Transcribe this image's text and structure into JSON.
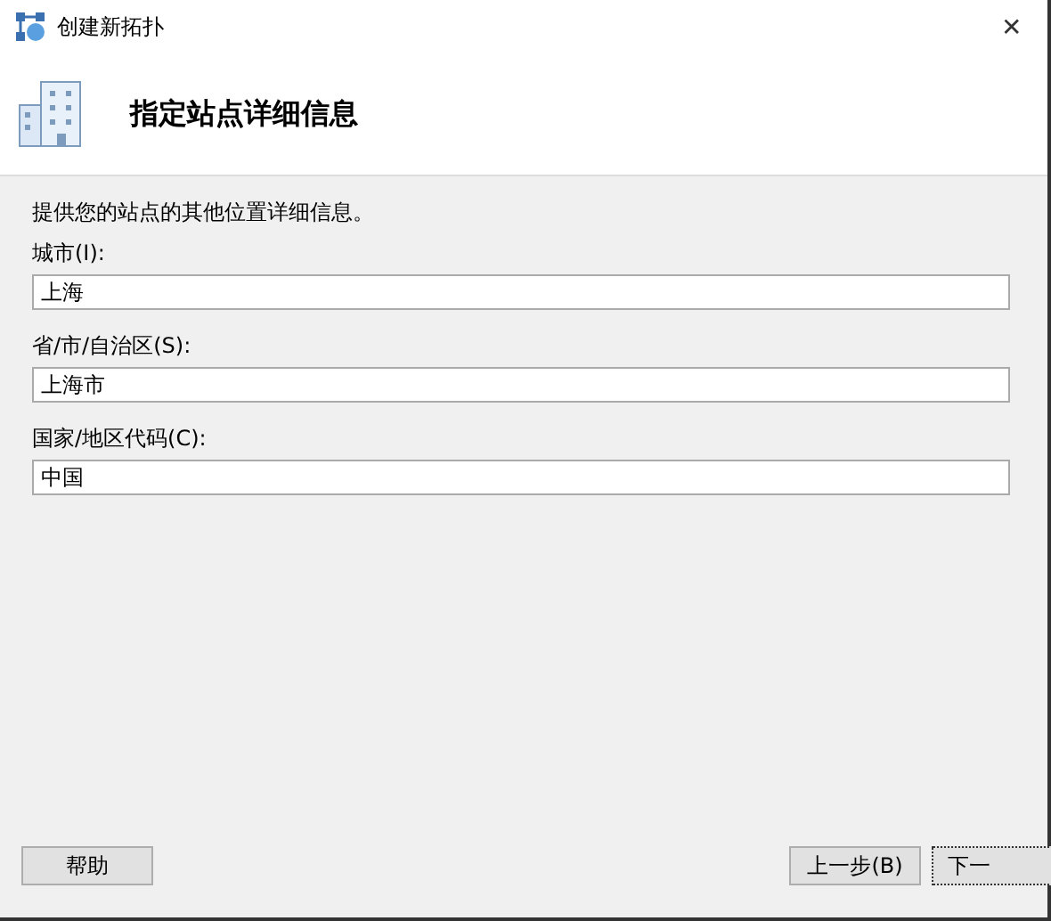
{
  "window": {
    "title": "创建新拓扑",
    "close": "✕"
  },
  "header": {
    "title": "指定站点详细信息"
  },
  "intro": "提供您的站点的其他位置详细信息。",
  "fields": [
    {
      "label": "城市(I):",
      "value": "上海"
    },
    {
      "label": "省/市/自治区(S):",
      "value": "上海市"
    },
    {
      "label": "国家/地区代码(C):",
      "value": "中国"
    }
  ],
  "buttons": {
    "help": "帮助",
    "back": "上一步(B)",
    "next": "下一"
  }
}
